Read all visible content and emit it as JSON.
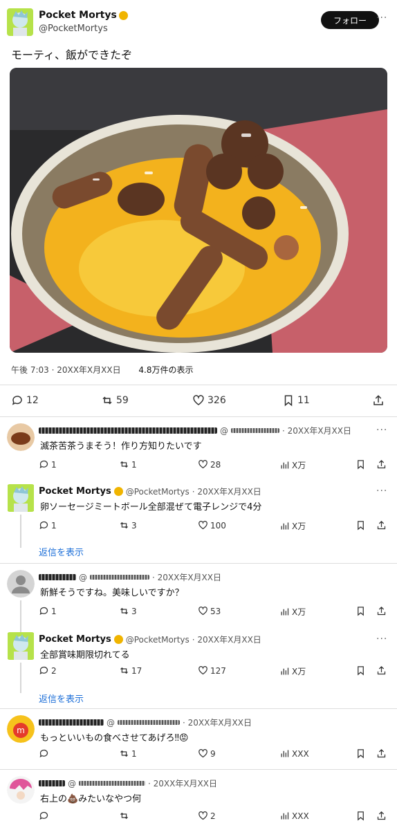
{
  "post": {
    "display_name": "Pocket Mortys",
    "handle": "@PocketMortys",
    "follow_label": "フォロー",
    "more_label": "···",
    "text": "モーティ、飯ができたぞ",
    "time": "午後 7:03 · 20XX年X月XX日",
    "views": "4.8万件の表示",
    "stats": {
      "replies": "12",
      "reposts": "59",
      "likes": "326",
      "bookmarks": "11"
    }
  },
  "replies": [
    {
      "name": "",
      "handle": "@",
      "date": "· 20XX年X月XX日",
      "text": "滅茶苦茶うまそう！作り方知りたいです",
      "counts": {
        "replies": "1",
        "reposts": "1",
        "likes": "28",
        "views": "X万"
      }
    },
    {
      "name": "Pocket Mortys",
      "handle": "@PocketMortys",
      "date": "· 20XX年X月XX日",
      "text": "卵ソーセージミートボール全部混ぜて電子レンジで4分",
      "counts": {
        "replies": "1",
        "reposts": "3",
        "likes": "100",
        "views": "X万"
      },
      "show_replies": "返信を表示"
    },
    {
      "name": "",
      "handle": "@",
      "date": "· 20XX年X月XX日",
      "text": "新鮮そうですね。美味しいですか？",
      "counts": {
        "replies": "1",
        "reposts": "3",
        "likes": "53",
        "views": "X万"
      }
    },
    {
      "name": "Pocket Mortys",
      "handle": "@PocketMortys",
      "date": "· 20XX年X月XX日",
      "text": "全部賞味期限切れてる",
      "counts": {
        "replies": "2",
        "reposts": "17",
        "likes": "127",
        "views": "X万"
      },
      "show_replies": "返信を表示"
    },
    {
      "name": "",
      "handle": "@",
      "date": "· 20XX年X月XX日",
      "text": "もっといいもの食べさせてあげろ‼︎😡",
      "counts": {
        "replies": "",
        "reposts": "1",
        "likes": "9",
        "views": "XXX"
      }
    },
    {
      "name": "",
      "handle": "@",
      "date": "· 20XX年X月XX日",
      "text": "右上の💩みたいなやつ何",
      "counts": {
        "replies": "",
        "reposts": "",
        "likes": "2",
        "views": "XXX"
      }
    }
  ],
  "colors": {
    "link": "#1d6fd8",
    "verified": "#f0b400",
    "accent_dark": "#111111"
  }
}
